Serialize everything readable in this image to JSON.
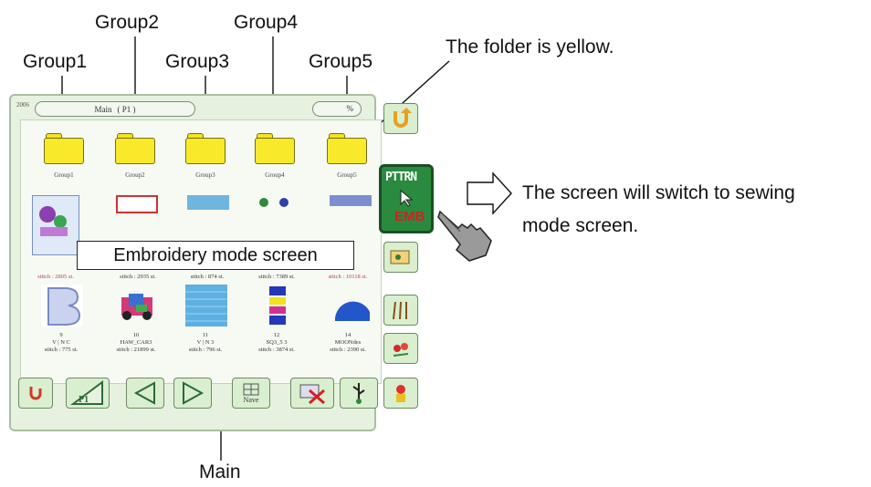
{
  "annotations": {
    "group1": "Group1",
    "group2": "Group2",
    "group3": "Group3",
    "group4": "Group4",
    "group5": "Group5",
    "folder_note": "The folder is yellow.",
    "switch_note_line1": "The screen will switch to sewing",
    "switch_note_line2": "mode screen.",
    "callout": "Embroidery mode screen",
    "main": "Main"
  },
  "panel": {
    "title": "Main",
    "page": "( P1 )",
    "zoom": "%",
    "folders": [
      {
        "label": "Group1",
        "icon": "folder-icon"
      },
      {
        "label": "Group2",
        "icon": "folder-icon"
      },
      {
        "label": "Group3",
        "icon": "folder-icon"
      },
      {
        "label": "Group4",
        "icon": "folder-icon"
      },
      {
        "label": "Group5",
        "icon": "folder-icon"
      }
    ],
    "row2_captions": [
      "stitch : 2805 st.",
      "stitch : 2935 st.",
      "stitch : 874 st.",
      "stitch : 7389 st.",
      "stitch : 10118 st."
    ],
    "row3": [
      {
        "num": "9",
        "name": "V | N C",
        "stitch": "stitch : 775 st."
      },
      {
        "num": "10",
        "name": "HAW_CAR3",
        "stitch": "stitch : 21899 st."
      },
      {
        "num": "11",
        "name": "V | N 3",
        "stitch": "stitch : 796 st."
      },
      {
        "num": "12",
        "name": "SQ3_5 3",
        "stitch": "stitch : 3874 st."
      },
      {
        "num": "14",
        "name": "MOONdes",
        "stitch": "stitch : 2390 st."
      }
    ],
    "pttrn_button": {
      "top": "PTTRN",
      "bottom": "EMB"
    },
    "bottom_buttons": [
      "Nave"
    ],
    "colors": {
      "folder": "#f8ea2a",
      "panel": "#e6f2df",
      "pttrn": "#2a8a3f"
    }
  }
}
